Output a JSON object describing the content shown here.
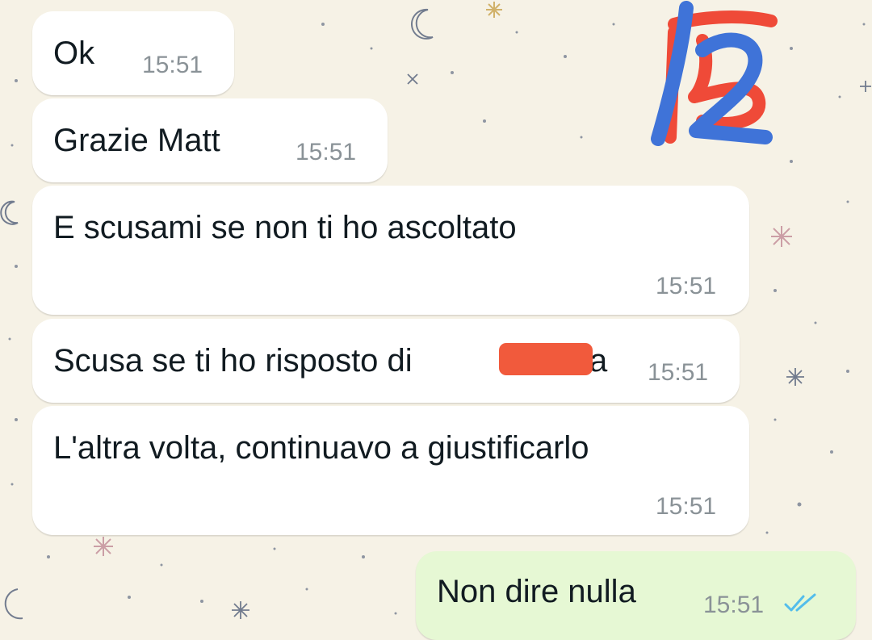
{
  "messages": [
    {
      "direction": "incoming",
      "text": "Ok",
      "time": "15:51"
    },
    {
      "direction": "incoming",
      "text": "Grazie Matt",
      "time": "15:51"
    },
    {
      "direction": "incoming",
      "text": "E scusami se non ti ho ascoltato",
      "time": "15:51"
    },
    {
      "direction": "incoming",
      "text_before_redaction": "Scusa se ti ho risposto di ",
      "text_after_redaction": "a",
      "time": "15:51"
    },
    {
      "direction": "incoming",
      "text": "L'altra volta, continuavo a giustificarlo",
      "time": "15:51"
    },
    {
      "direction": "outgoing",
      "text": "Non dire nulla",
      "time": "15:51",
      "status": "read"
    }
  ],
  "icons": {
    "read_receipt": "double-check-icon"
  },
  "colors": {
    "wallpaper": "#f6f2e6",
    "incoming_bubble": "#ffffff",
    "outgoing_bubble": "#e6f8d4",
    "text": "#111b21",
    "timestamp": "#8a9297",
    "read_ticks": "#53bdeb",
    "redaction": "#f15a3c",
    "marker_blue": "#3f73d8",
    "marker_red": "#ef4a38"
  }
}
